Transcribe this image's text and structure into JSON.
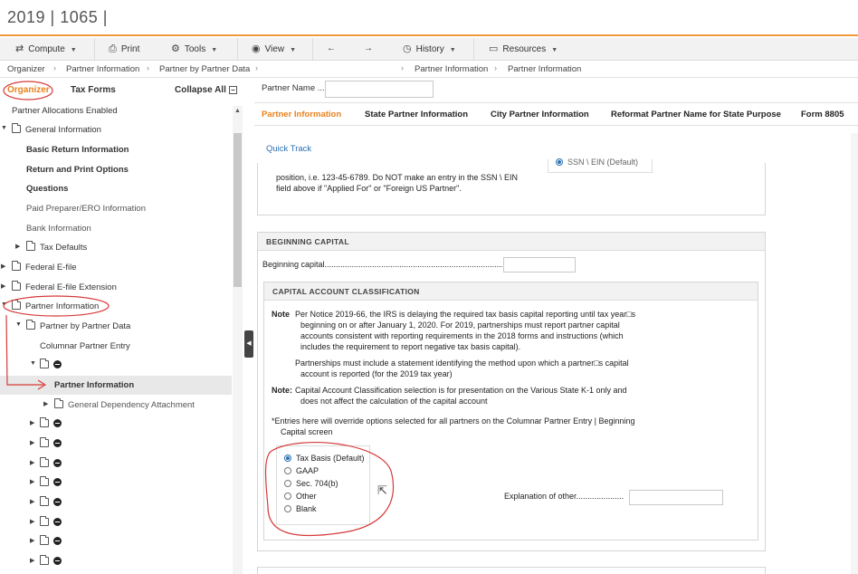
{
  "app": {
    "title": "2019 | 1065 |"
  },
  "toolbar": {
    "compute": "Compute",
    "print": "Print",
    "tools": "Tools",
    "view": "View",
    "history": "History",
    "resources": "Resources",
    "icons": {
      "compute": "swap-arrows-icon",
      "print": "printer-icon",
      "tools": "gear-icon",
      "view": "eye-icon",
      "back": "arrow-left-icon",
      "forward": "arrow-right-icon",
      "history": "clock-icon",
      "resources": "briefcase-icon"
    }
  },
  "breadcrumb": {
    "left": [
      "Organizer",
      "Partner Information",
      "Partner by Partner Data"
    ],
    "right": [
      "Partner Information",
      "Partner Information"
    ]
  },
  "sidebar": {
    "tabs": {
      "organizer": "Organizer",
      "tax_forms": "Tax Forms",
      "collapse_all": "Collapse All"
    },
    "items": [
      {
        "label": "Partner Allocations Enabled"
      },
      {
        "label": "General Information"
      },
      {
        "label": "Basic Return Information"
      },
      {
        "label": "Return and Print Options"
      },
      {
        "label": "Questions"
      },
      {
        "label": "Paid Preparer/ERO Information"
      },
      {
        "label": "Bank Information"
      },
      {
        "label": "Tax Defaults"
      },
      {
        "label": "Federal E-file"
      },
      {
        "label": "Federal E-file Extension"
      },
      {
        "label": "Partner Information"
      },
      {
        "label": "Partner by Partner Data"
      },
      {
        "label": "Columnar Partner Entry"
      },
      {
        "label": "Partner Information"
      },
      {
        "label": "General Dependency Attachment"
      }
    ]
  },
  "main": {
    "partner_name_label": "Partner Name ...",
    "tabs": [
      "Partner Information",
      "State Partner Information",
      "City Partner Information",
      "Reformat Partner Name for State Purpose",
      "Form 8805"
    ],
    "quick_track": "Quick Track",
    "ssn_option": "SSN \\ EIN (Default)",
    "ssn_note_1": "position, i.e. 123-45-6789. Do NOT make an entry in the SSN \\ EIN",
    "ssn_note_2": "field above if \"Applied For\" or \"Foreign US Partner\".",
    "beginning_capital": {
      "header": "BEGINNING CAPITAL",
      "label": "Beginning capital..........................................................................................."
    },
    "classification": {
      "header": "CAPITAL ACCOUNT CLASSIFICATION",
      "note_label": "Note",
      "note_lines": [
        "Per Notice 2019-66, the IRS is delaying the required tax basis capital reporting until tax year□s",
        "beginning on or after January 1, 2020. For 2019, partnerships must report partner capital",
        "accounts consistent with reporting requirements in the 2018 forms and instructions (which",
        "includes the requirement to report negative tax basis capital)."
      ],
      "statement_lines": [
        "Partnerships must include a statement identifying the method upon which a partner□s capital",
        "account is reported (for the 2019 tax year)"
      ],
      "note2_label": "Note:",
      "note2_lines": [
        "Capital Account Classification selection is for presentation on the Various State K-1 only and",
        "does not affect the calculation of the capital account"
      ],
      "override_lines": [
        "*Entries here will override options selected for all partners on the Columnar Partner Entry | Beginning",
        "Capital screen"
      ],
      "options": [
        "Tax Basis (Default)",
        "GAAP",
        "Sec. 704(b)",
        "Other",
        "Blank"
      ],
      "selected": "Tax Basis (Default)",
      "explanation_label": "Explanation of other....................."
    }
  },
  "colors": {
    "accent": "#e8811c",
    "link": "#2a6fb3",
    "annotation": "#d63a3a"
  }
}
